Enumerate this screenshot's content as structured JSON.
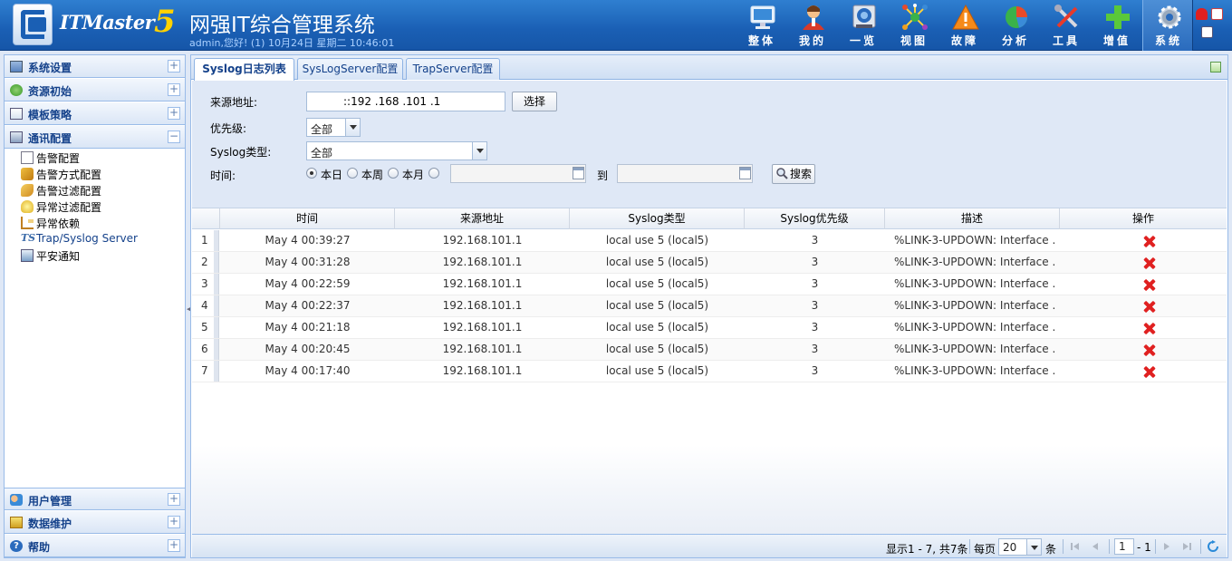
{
  "header": {
    "brand": "ITMaster",
    "brand_version": "5",
    "title": "网强IT综合管理系统",
    "user_info": "admin,您好! (1) 10月24日 星期二 10:46:01",
    "nav": [
      {
        "label": "整体",
        "icon": "monitor-icon"
      },
      {
        "label": "我的",
        "icon": "user-icon"
      },
      {
        "label": "一览",
        "icon": "overview-icon"
      },
      {
        "label": "视图",
        "icon": "topology-icon"
      },
      {
        "label": "故障",
        "icon": "warning-icon"
      },
      {
        "label": "分析",
        "icon": "pie-chart-icon"
      },
      {
        "label": "工具",
        "icon": "tools-icon"
      },
      {
        "label": "增值",
        "icon": "plus-icon"
      },
      {
        "label": "系统",
        "icon": "gear-icon",
        "active": true
      }
    ]
  },
  "sidebar": {
    "sections_top": [
      {
        "label": "系统设置",
        "toggle": "+"
      },
      {
        "label": "资源初始",
        "toggle": "+"
      },
      {
        "label": "模板策略",
        "toggle": "+"
      },
      {
        "label": "通讯配置",
        "toggle": "−"
      }
    ],
    "items": [
      {
        "label": "告警配置",
        "icon": "doc-icon"
      },
      {
        "label": "告警方式配置",
        "icon": "wrench-icon"
      },
      {
        "label": "告警过滤配置",
        "icon": "filter-icon"
      },
      {
        "label": "异常过滤配置",
        "icon": "bulb-icon"
      },
      {
        "label": "异常依赖",
        "icon": "tree-icon"
      },
      {
        "label": "Trap/Syslog Server",
        "icon": "ts-icon"
      },
      {
        "label": "平安通知",
        "icon": "notice-icon"
      }
    ],
    "sections_bottom": [
      {
        "label": "用户管理",
        "toggle": "+"
      },
      {
        "label": "数据维护",
        "toggle": "+"
      },
      {
        "label": "帮助",
        "toggle": "+"
      }
    ]
  },
  "tabs": [
    {
      "label": "Syslog日志列表",
      "active": true
    },
    {
      "label": "SysLogServer配置"
    },
    {
      "label": "TrapServer配置"
    }
  ],
  "form": {
    "source_label": "来源地址:",
    "source_value": "::192  .168  .101  .1",
    "choose_button": "选择",
    "priority_label": "优先级:",
    "priority_value": "全部",
    "syslog_type_label": "Syslog类型:",
    "syslog_type_value": "全部",
    "time_label": "时间:",
    "radios": [
      {
        "label": "本日",
        "checked": true
      },
      {
        "label": "本周",
        "checked": false
      },
      {
        "label": "本月",
        "checked": false
      },
      {
        "label": "",
        "checked": false
      }
    ],
    "to_label": "到",
    "search_button": "搜索"
  },
  "grid": {
    "columns": [
      "时间",
      "来源地址",
      "Syslog类型",
      "Syslog优先级",
      "描述",
      "操作"
    ],
    "rows": [
      {
        "n": "1",
        "time": "May 4 00:39:27",
        "source": "192.168.101.1",
        "type": "local use 5 (local5)",
        "priority": "3",
        "desc": "%LINK-3-UPDOWN: Interface ..."
      },
      {
        "n": "2",
        "time": "May 4 00:31:28",
        "source": "192.168.101.1",
        "type": "local use 5 (local5)",
        "priority": "3",
        "desc": "%LINK-3-UPDOWN: Interface ..."
      },
      {
        "n": "3",
        "time": "May 4 00:22:59",
        "source": "192.168.101.1",
        "type": "local use 5 (local5)",
        "priority": "3",
        "desc": "%LINK-3-UPDOWN: Interface ..."
      },
      {
        "n": "4",
        "time": "May 4 00:22:37",
        "source": "192.168.101.1",
        "type": "local use 5 (local5)",
        "priority": "3",
        "desc": "%LINK-3-UPDOWN: Interface ..."
      },
      {
        "n": "5",
        "time": "May 4 00:21:18",
        "source": "192.168.101.1",
        "type": "local use 5 (local5)",
        "priority": "3",
        "desc": "%LINK-3-UPDOWN: Interface ..."
      },
      {
        "n": "6",
        "time": "May 4 00:20:45",
        "source": "192.168.101.1",
        "type": "local use 5 (local5)",
        "priority": "3",
        "desc": "%LINK-3-UPDOWN: Interface ..."
      },
      {
        "n": "7",
        "time": "May 4 00:17:40",
        "source": "192.168.101.1",
        "type": "local use 5 (local5)",
        "priority": "3",
        "desc": "%LINK-3-UPDOWN: Interface ..."
      }
    ]
  },
  "pager": {
    "summary": "显示1 - 7, 共7条",
    "per_page_label": "每页",
    "per_page_value": "20",
    "per_page_unit": "条",
    "page_value": "1",
    "page_total": "- 1"
  }
}
